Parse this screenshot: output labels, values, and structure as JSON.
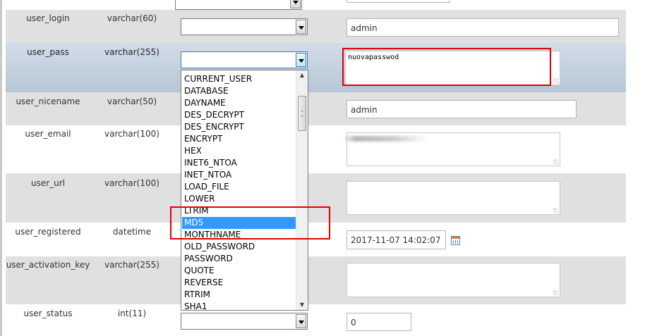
{
  "rows": [
    {
      "field": "user_login",
      "type": "varchar(60)",
      "value": "admin"
    },
    {
      "field": "user_pass",
      "type": "varchar(255)",
      "value": "nuovapasswod"
    },
    {
      "field": "user_nicename",
      "type": "varchar(50)",
      "value": "admin"
    },
    {
      "field": "user_email",
      "type": "varchar(100)",
      "value": ""
    },
    {
      "field": "user_url",
      "type": "varchar(100)",
      "value": ""
    },
    {
      "field": "user_registered",
      "type": "datetime",
      "value": "2017-11-07 14:02:07"
    },
    {
      "field": "user_activation_key",
      "type": "varchar(255)",
      "value": ""
    },
    {
      "field": "user_status",
      "type": "int(11)",
      "value": "0"
    }
  ],
  "function_dropdown": {
    "options": [
      "CURRENT_USER",
      "DATABASE",
      "DAYNAME",
      "DES_DECRYPT",
      "DES_ENCRYPT",
      "ENCRYPT",
      "HEX",
      "INET6_NTOA",
      "INET_NTOA",
      "LOAD_FILE",
      "LOWER",
      "LTRIM",
      "MD5",
      "MONTHNAME",
      "OLD_PASSWORD",
      "PASSWORD",
      "QUOTE",
      "REVERSE",
      "RTRIM",
      "SHA1"
    ],
    "highlighted": "MD5"
  },
  "colors": {
    "highlight": "#3399ff",
    "annotation": "#e00000",
    "row_selected": "#c3d1df"
  },
  "icons": [
    "dropdown-arrow-icon",
    "calendar-icon",
    "resize-grip-icon",
    "scroll-up-icon",
    "scroll-down-icon"
  ]
}
